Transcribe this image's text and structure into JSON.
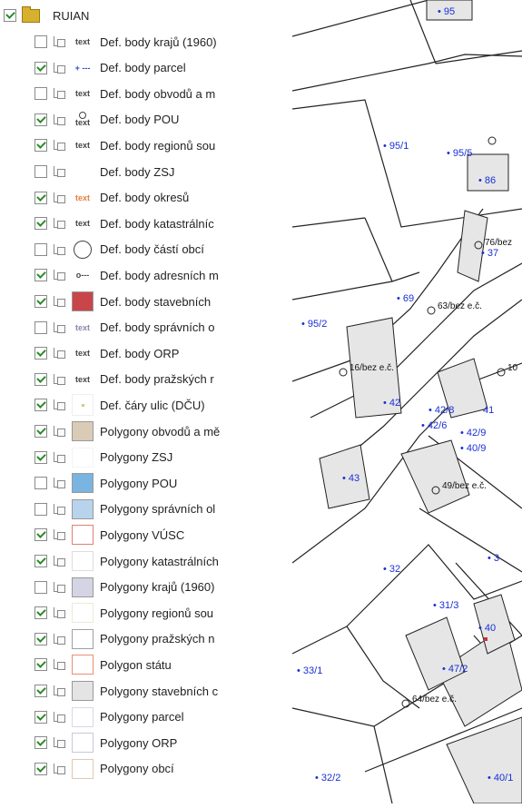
{
  "root": {
    "label": "RUIAN",
    "checked": true
  },
  "layers": [
    {
      "label": "Def. body krajů (1960)",
      "checked": false,
      "symbol": "text",
      "symbol_text": "text",
      "symbol_color": "#444444"
    },
    {
      "label": "Def. body parcel",
      "checked": true,
      "symbol": "text",
      "symbol_text": "+ ---",
      "symbol_color": "#3344cc"
    },
    {
      "label": "Def. body obvodů a m",
      "checked": false,
      "symbol": "text",
      "symbol_text": "text",
      "symbol_color": "#444444"
    },
    {
      "label": "Def. body POU",
      "checked": true,
      "symbol": "circle-text",
      "symbol_text": "text",
      "symbol_color": "#444444"
    },
    {
      "label": "Def. body regionů sou",
      "checked": true,
      "symbol": "text",
      "symbol_text": "text",
      "symbol_color": "#444444"
    },
    {
      "label": "Def. body ZSJ",
      "checked": false,
      "symbol": "box",
      "symbol_color": "#ffffff"
    },
    {
      "label": "Def. body okresů",
      "checked": true,
      "symbol": "text",
      "symbol_text": "text",
      "symbol_color": "#e08040"
    },
    {
      "label": "Def. body katastrálníc",
      "checked": true,
      "symbol": "text",
      "symbol_text": "text",
      "symbol_color": "#444444"
    },
    {
      "label": "Def. body částí obcí",
      "checked": false,
      "symbol": "circle",
      "symbol_color": "#444444"
    },
    {
      "label": "Def. body adresních m",
      "checked": true,
      "symbol": "text",
      "symbol_text": "o---",
      "symbol_color": "#444444"
    },
    {
      "label": "Def. body stavebních",
      "checked": true,
      "symbol": "fill",
      "symbol_color": "#c8464a"
    },
    {
      "label": "Def. body správních o",
      "checked": false,
      "symbol": "text",
      "symbol_text": "text",
      "symbol_color": "#8888aa"
    },
    {
      "label": "Def. body ORP",
      "checked": true,
      "symbol": "text",
      "symbol_text": "text",
      "symbol_color": "#444444"
    },
    {
      "label": "Def. body pražských r",
      "checked": true,
      "symbol": "text",
      "symbol_text": "text",
      "symbol_color": "#444444"
    },
    {
      "label": "Def. čáry ulic (DČU)",
      "checked": true,
      "symbol": "dot",
      "symbol_color": "#cccc88"
    },
    {
      "label": "Polygony obvodů a mě",
      "checked": true,
      "symbol": "fill",
      "symbol_color": "#d9cbb6"
    },
    {
      "label": "Polygony ZSJ",
      "checked": true,
      "symbol": "box",
      "symbol_color": "#f4f4f4"
    },
    {
      "label": "Polygony POU",
      "checked": false,
      "symbol": "fill",
      "symbol_color": "#7ab4e0"
    },
    {
      "label": "Polygony správních ol",
      "checked": false,
      "symbol": "fill",
      "symbol_color": "#b8d4ec"
    },
    {
      "label": "Polygony VÚSC",
      "checked": true,
      "symbol": "box",
      "symbol_color": "#e08070"
    },
    {
      "label": "Polygony katastrálních",
      "checked": true,
      "symbol": "box",
      "symbol_color": "#dddddd"
    },
    {
      "label": "Polygony krajů (1960)",
      "checked": false,
      "symbol": "fill",
      "symbol_color": "#d4d4e4"
    },
    {
      "label": "Polygony regionů sou",
      "checked": true,
      "symbol": "box",
      "symbol_color": "#e6ecd8"
    },
    {
      "label": "Polygony pražských n",
      "checked": true,
      "symbol": "box",
      "symbol_color": "#a0a0a0"
    },
    {
      "label": "Polygon státu",
      "checked": true,
      "symbol": "box",
      "symbol_color": "#e89070"
    },
    {
      "label": "Polygony stavebních c",
      "checked": true,
      "symbol": "fill",
      "symbol_color": "#e4e4e4"
    },
    {
      "label": "Polygony parcel",
      "checked": true,
      "symbol": "box",
      "symbol_color": "#d8d8e8"
    },
    {
      "label": "Polygony ORP",
      "checked": true,
      "symbol": "box",
      "symbol_color": "#c8c8d8"
    },
    {
      "label": "Polygony obcí",
      "checked": true,
      "symbol": "box",
      "symbol_color": "#e0c8b0"
    }
  ],
  "map": {
    "parcel_color": "#1a2fd6",
    "building_color": "#e6e6e6",
    "parcel_labels": [
      "95",
      "95/1",
      "95/5",
      "86",
      "37",
      "69",
      "95/2",
      "42",
      "42/8",
      "41",
      "42/6",
      "42/9",
      "40/9",
      "43",
      "3",
      "32",
      "31/3",
      "40",
      "47/2",
      "33/1",
      "32/2",
      "40/1"
    ],
    "address_labels": [
      "76/bez",
      "63/bez e.č.",
      "16/bez e.č.",
      "10",
      "49/bez e.č.",
      "64/bez e.č."
    ]
  }
}
